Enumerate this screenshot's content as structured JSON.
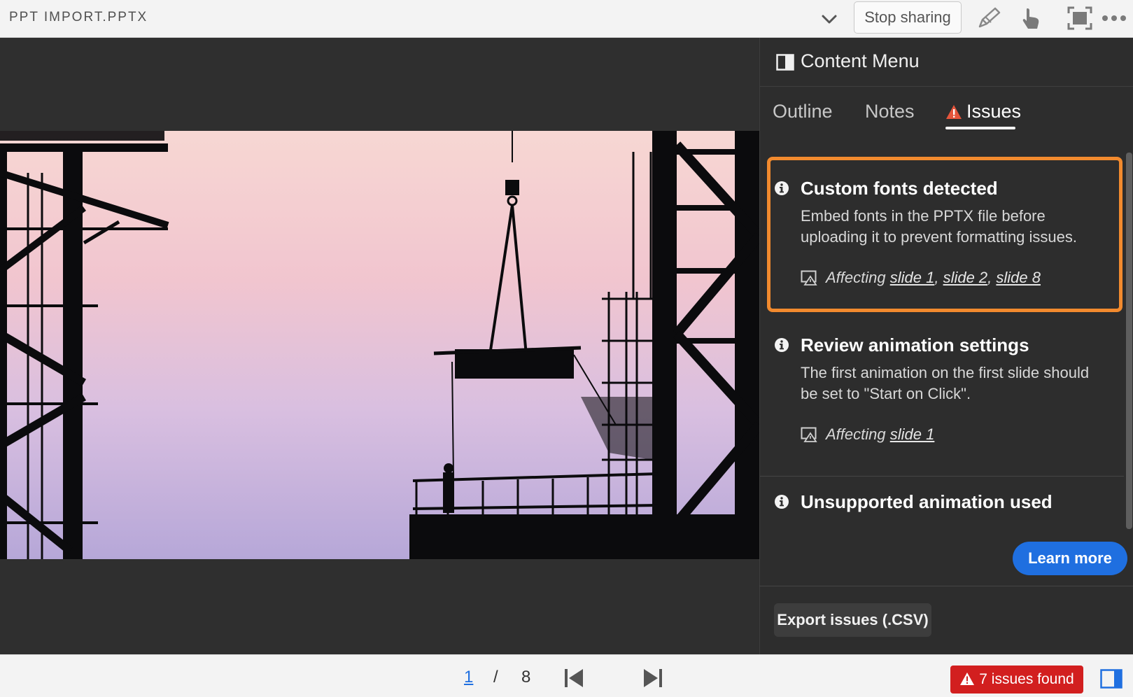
{
  "header": {
    "document_title": "PPT IMPORT.PPTX",
    "stop_sharing_label": "Stop sharing"
  },
  "icons": {
    "chevron": "chevron-down-icon",
    "annotate": "pen-icon",
    "pointer": "hand-pointer-icon",
    "fullscreen": "fullscreen-icon",
    "more": "more-icon"
  },
  "panel": {
    "title": "Content Menu",
    "tabs": [
      {
        "label": "Outline",
        "active": false
      },
      {
        "label": "Notes",
        "active": false
      },
      {
        "label": "Issues",
        "active": true
      }
    ],
    "issues": [
      {
        "title": "Custom fonts detected",
        "description": "Embed fonts in the PPTX file before uploading it to prevent formatting issues.",
        "affecting_label": "Affecting",
        "slides": [
          "slide 1",
          "slide 2",
          "slide 8"
        ],
        "selected": true
      },
      {
        "title": "Review animation settings",
        "description": "The first animation on the first slide should be set to \"Start on Click\".",
        "affecting_label": "Affecting",
        "slides": [
          "slide 1"
        ],
        "selected": false
      },
      {
        "title": "Unsupported animation used"
      }
    ],
    "learn_more_label": "Learn more",
    "export_label": "Export issues (.CSV)"
  },
  "footer": {
    "current_page": "1",
    "separator": "/",
    "total_pages": "8",
    "issues_found_label": "7 issues found"
  },
  "colors": {
    "accent_blue": "#1f6fe0",
    "highlight_orange": "#f28a2e",
    "warning_red": "#d21f1f",
    "panel_bg": "#2d2d2d",
    "stage_bg": "#2f2f2f"
  }
}
